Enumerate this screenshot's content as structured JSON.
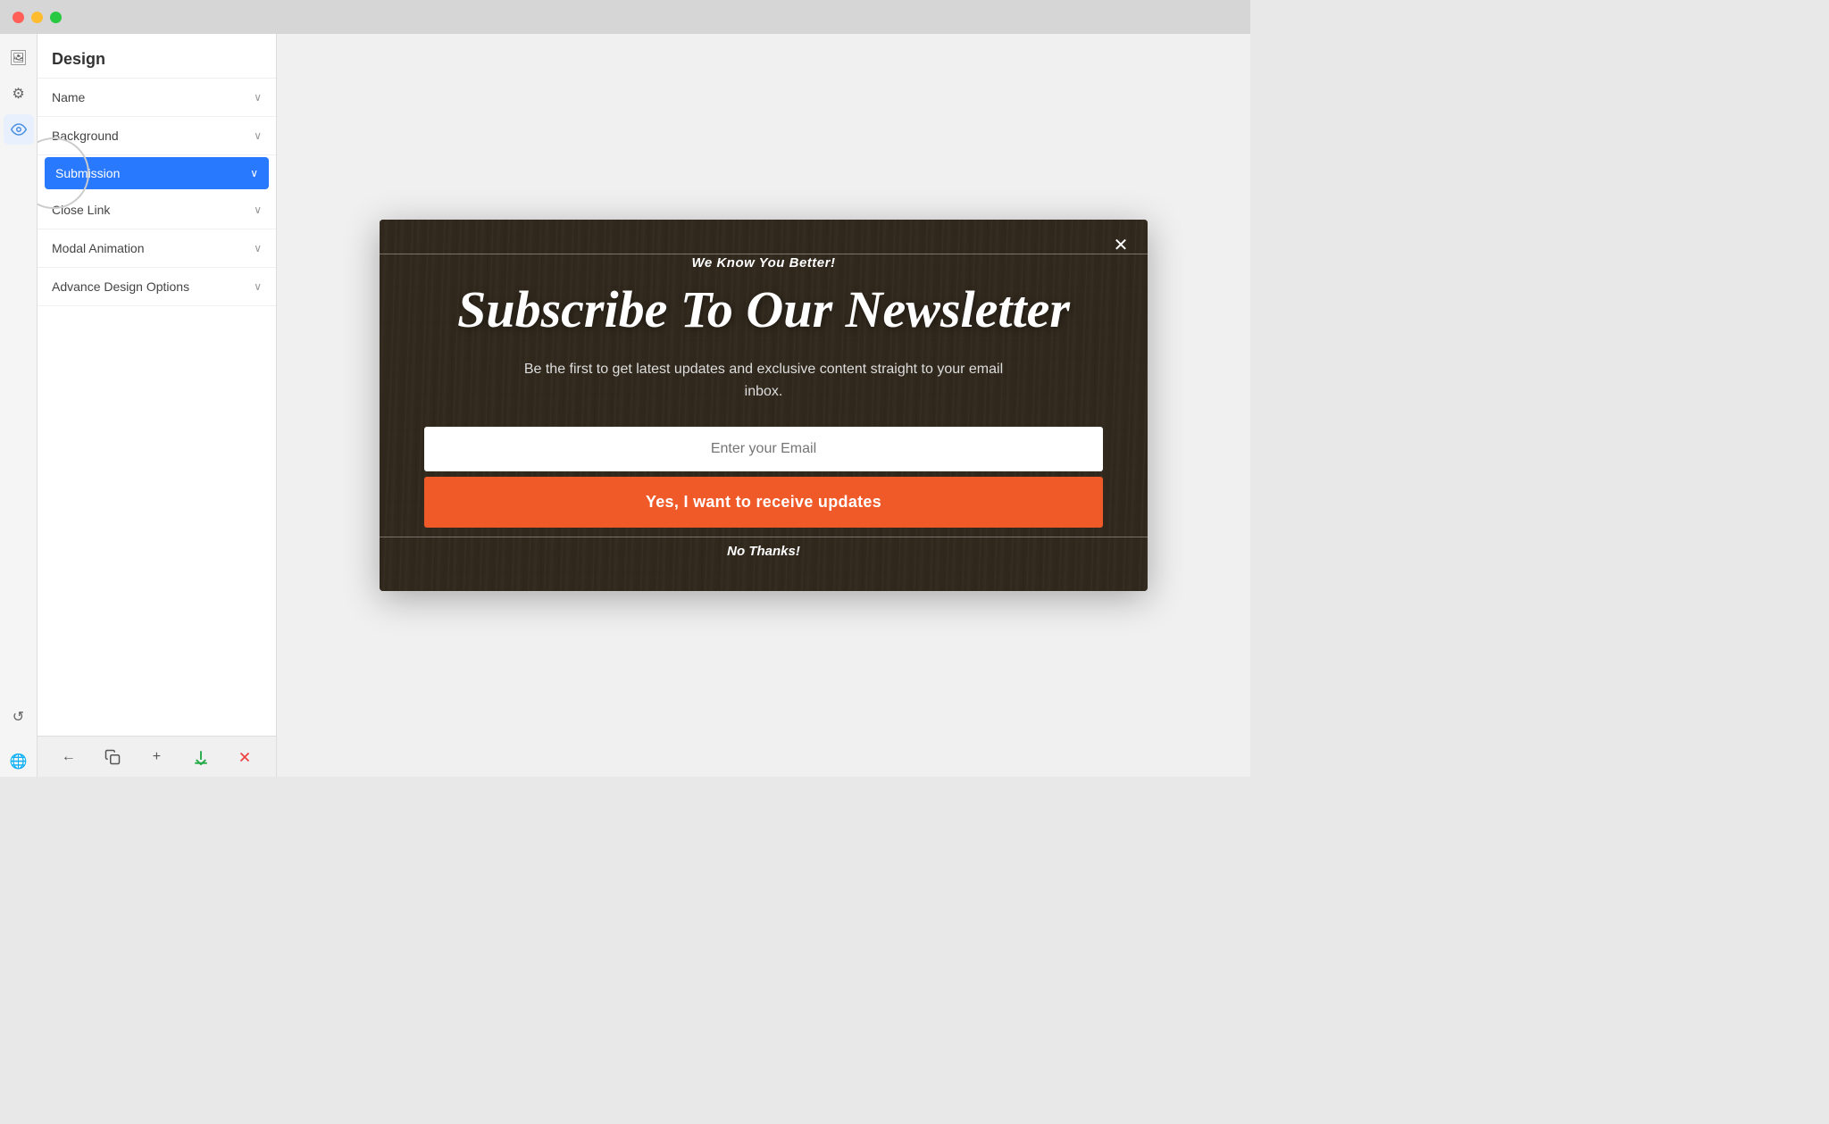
{
  "titlebar": {
    "buttons": [
      "close",
      "minimize",
      "maximize"
    ]
  },
  "sidebar": {
    "title": "Design",
    "items": [
      {
        "id": "name",
        "label": "Name",
        "active": false
      },
      {
        "id": "background",
        "label": "Background",
        "active": false
      },
      {
        "id": "submission",
        "label": "Submission",
        "active": true
      },
      {
        "id": "close-link",
        "label": "Close Link",
        "active": false
      },
      {
        "id": "modal-animation",
        "label": "Modal Animation",
        "active": false
      },
      {
        "id": "advance-design",
        "label": "Advance Design Options",
        "active": false
      }
    ]
  },
  "toolbar": {
    "back_label": "←",
    "duplicate_label": "⧉",
    "add_label": "+",
    "download_label": "↓",
    "close_label": "×"
  },
  "modal": {
    "tagline": "We Know You Better!",
    "title": "Subscribe To Our Newsletter",
    "description": "Be the first to get latest updates and exclusive content straight to your email inbox.",
    "email_placeholder": "Enter your Email",
    "submit_label": "Yes, I want to receive updates",
    "no_thanks_label": "No Thanks!",
    "close_icon": "✕"
  },
  "icons": {
    "image": "🖼",
    "gear": "⚙",
    "eye": "👁",
    "refresh": "↺",
    "globe": "🌐"
  }
}
